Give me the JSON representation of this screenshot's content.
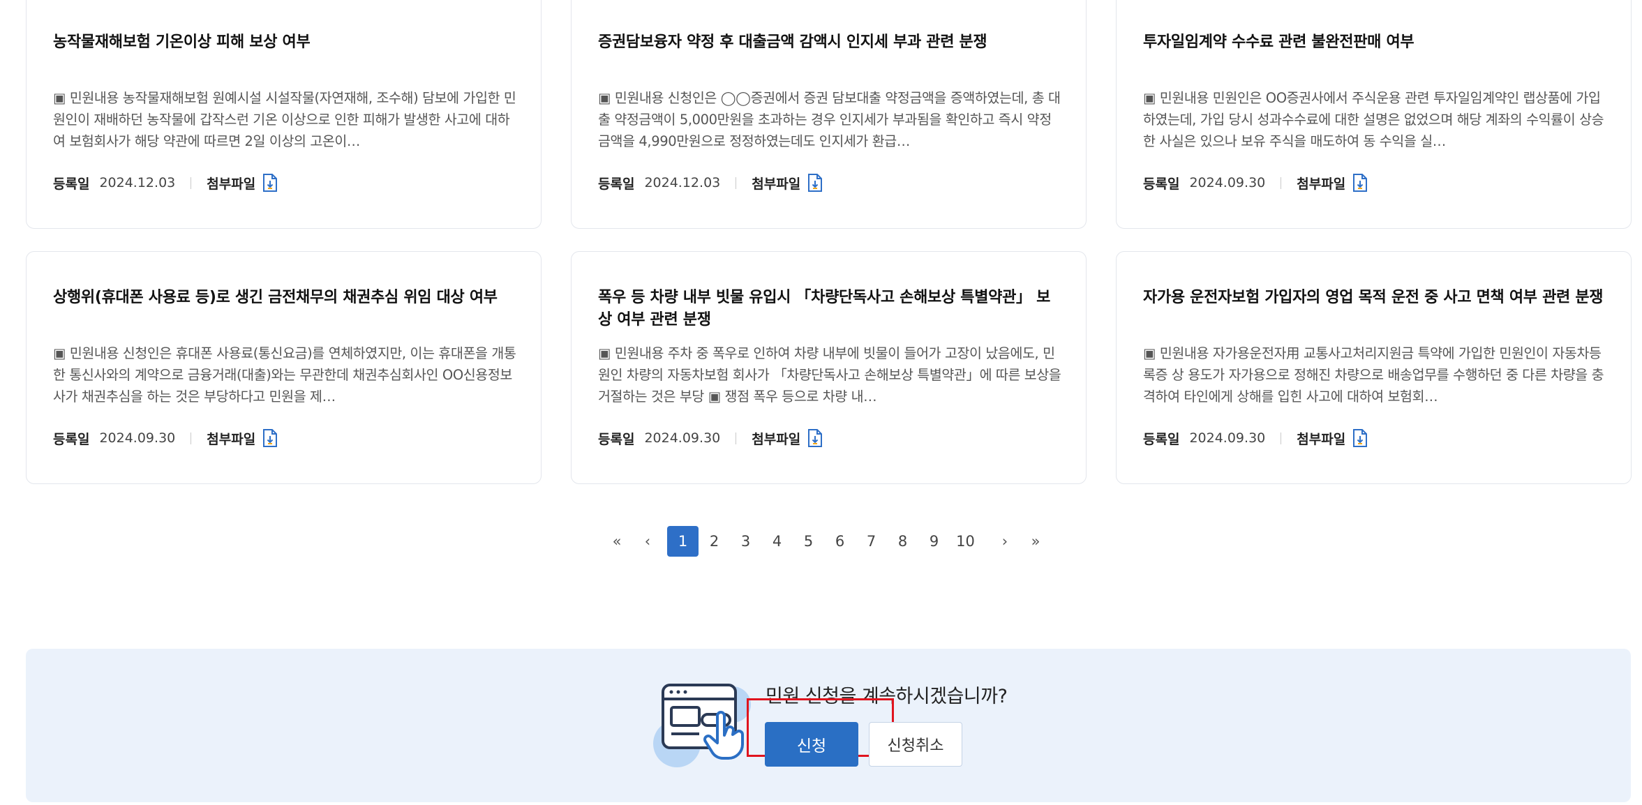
{
  "cards": [
    {
      "title": "농작물재해보험 기온이상 피해 보상 여부",
      "body": "▣ 민원내용 농작물재해보험 원예시설 시설작물(자연재해, 조수해) 담보에 가입한 민원인이 재배하던 농작물에 갑작스런 기온 이상으로 인한 피해가 발생한 사고에 대하여 보험회사가 해당 약관에 따르면 2일 이상의 고온이…",
      "date_label": "등록일",
      "date": "2024.12.03",
      "file_label": "첨부파일"
    },
    {
      "title": "증권담보융자 약정 후 대출금액 감액시 인지세 부과 관련 분쟁",
      "body": "▣ 민원내용 신청인은 ◯◯증권에서 증권 담보대출 약정금액을 증액하였는데, 총 대출 약정금액이 5,000만원을 초과하는 경우 인지세가 부과됨을 확인하고 즉시 약정금액을 4,990만원으로 정정하였는데도 인지세가 환급…",
      "date_label": "등록일",
      "date": "2024.12.03",
      "file_label": "첨부파일"
    },
    {
      "title": "투자일임계약 수수료 관련 불완전판매 여부",
      "body": "▣ 민원내용 민원인은 OO증권사에서 주식운용 관련 투자일임계약인 랩상품에 가입하였는데, 가입 당시 성과수수료에 대한 설명은 없었으며 해당 계좌의 수익률이 상승한 사실은 있으나 보유 주식을 매도하여 동 수익을 실…",
      "date_label": "등록일",
      "date": "2024.09.30",
      "file_label": "첨부파일"
    },
    {
      "title": "상행위(휴대폰 사용료 등)로 생긴 금전채무의 채권추심 위임 대상 여부",
      "body": "▣ 민원내용 신청인은 휴대폰 사용료(통신요금)를 연체하였지만, 이는 휴대폰을 개통한 통신사와의 계약으로 금융거래(대출)와는 무관한데 채권추심회사인 OO신용정보사가 채권추심을 하는 것은 부당하다고 민원을 제…",
      "date_label": "등록일",
      "date": "2024.09.30",
      "file_label": "첨부파일"
    },
    {
      "title": "폭우 등 차량 내부 빗물 유입시 「차량단독사고 손해보상 특별약관」 보상 여부 관련 분쟁",
      "body": "▣ 민원내용 주차 중 폭우로 인하여 차량 내부에 빗물이 들어가 고장이 났음에도, 민원인 차량의 자동차보험 회사가 「차량단독사고 손해보상 특별약관」에 따른 보상을 거절하는 것은 부당 ▣ 쟁점 폭우 등으로 차량 내…",
      "date_label": "등록일",
      "date": "2024.09.30",
      "file_label": "첨부파일"
    },
    {
      "title": "자가용 운전자보험 가입자의 영업 목적 운전 중 사고 면책 여부 관련 분쟁",
      "body": "▣ 민원내용 자가용운전자用 교통사고처리지원금 특약에 가입한 민원인이 자동차등록증 상 용도가 자가용으로 정해진 차량으로 배송업무를 수행하던 중 다른 차량을 충격하여 타인에게 상해를 입힌 사고에 대하여 보험회…",
      "date_label": "등록일",
      "date": "2024.09.30",
      "file_label": "첨부파일"
    }
  ],
  "pagination": {
    "first": "«",
    "prev": "‹",
    "pages": [
      "1",
      "2",
      "3",
      "4",
      "5",
      "6",
      "7",
      "8",
      "9",
      "10"
    ],
    "current": "1",
    "next": "›",
    "last": "»"
  },
  "confirm": {
    "question": "민원 신청을 계속하시겠습니까?",
    "apply_label": "신청",
    "cancel_label": "신청취소"
  },
  "colors": {
    "accent": "#2e6fc7",
    "panel_bg": "#ebf2fb",
    "highlight_frame": "#e0141e"
  },
  "icons": {
    "file": "download-file-icon",
    "illustration": "web-click-hand-icon"
  }
}
